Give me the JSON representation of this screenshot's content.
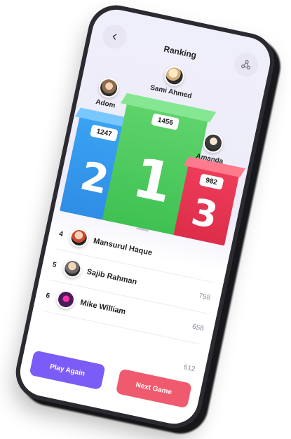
{
  "header": {
    "title": "Ranking",
    "back_icon": "chevron-left-icon",
    "share_icon": "share-nodes-icon"
  },
  "podium": [
    {
      "place": 1,
      "digit": "1",
      "name": "Sami Ahmed",
      "score": "1456",
      "color": "#3fc152"
    },
    {
      "place": 2,
      "digit": "2",
      "name": "Adom",
      "score": "1247",
      "color": "#2f8de6"
    },
    {
      "place": 3,
      "digit": "3",
      "name": "Amanda",
      "score": "982",
      "color": "#dd2d49"
    }
  ],
  "list": [
    {
      "rank": "4",
      "name": "Mansurul Haque",
      "points": ""
    },
    {
      "rank": "5",
      "name": "Sajib Rahman",
      "points": "758"
    },
    {
      "rank": "6",
      "name": "Mike William",
      "points": "658"
    },
    {
      "rank": "",
      "name": "",
      "points": "612"
    }
  ],
  "buttons": {
    "play_again": "Play Again",
    "next_game": "Next Game",
    "play_color": "#7b5cf6",
    "next_color": "#f05a6e"
  }
}
